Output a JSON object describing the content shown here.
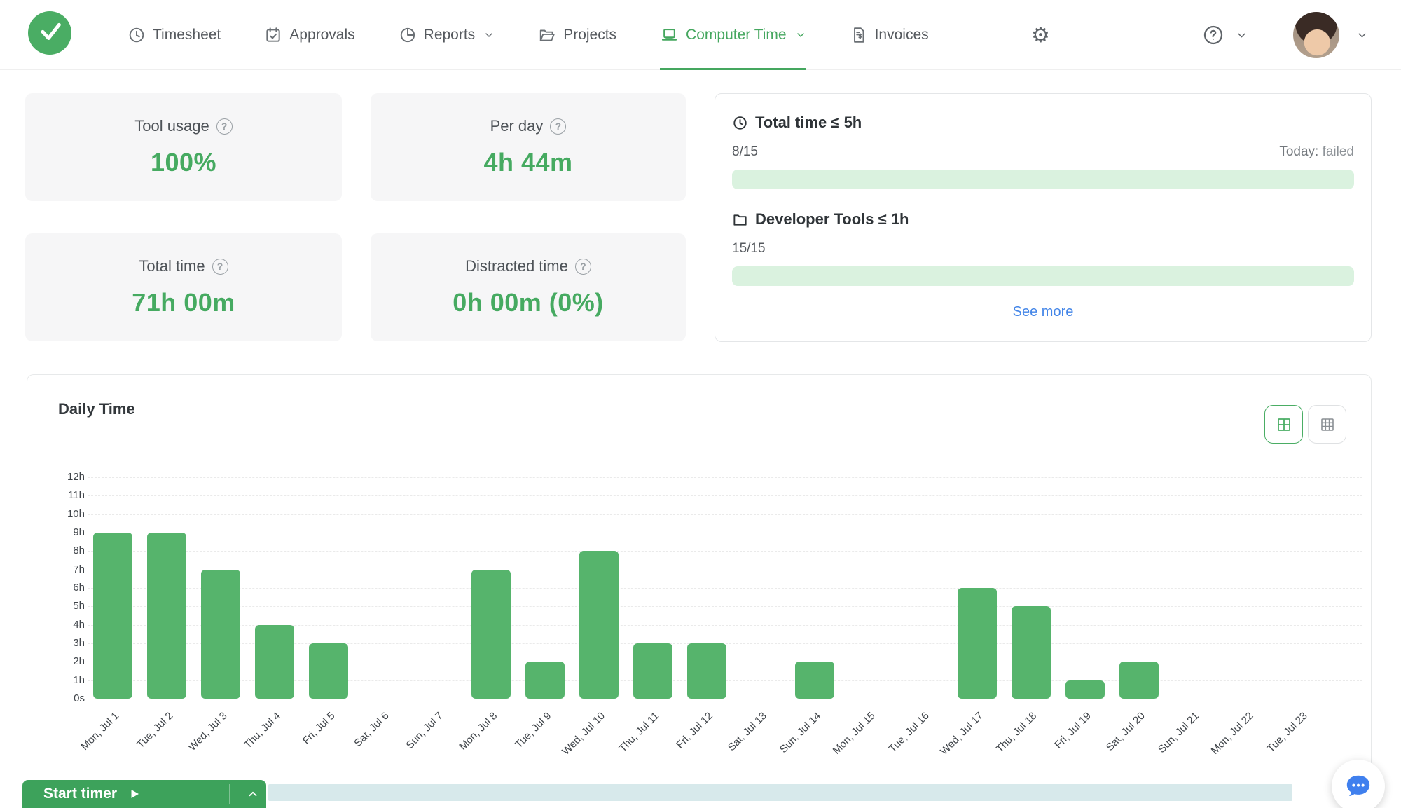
{
  "nav": {
    "items": [
      {
        "label": "Timesheet",
        "icon": "clock-icon",
        "active": false,
        "has_dropdown": false
      },
      {
        "label": "Approvals",
        "icon": "calendar-check-icon",
        "active": false,
        "has_dropdown": false
      },
      {
        "label": "Reports",
        "icon": "pie-chart-icon",
        "active": false,
        "has_dropdown": true
      },
      {
        "label": "Projects",
        "icon": "folder-icon",
        "active": false,
        "has_dropdown": false
      },
      {
        "label": "Computer Time",
        "icon": "laptop-icon",
        "active": true,
        "has_dropdown": true
      },
      {
        "label": "Invoices",
        "icon": "invoice-icon",
        "active": false,
        "has_dropdown": false
      }
    ],
    "right_icons": [
      "gear-icon",
      "help-icon",
      "avatar",
      "chevron-down-icon"
    ]
  },
  "summary_cards": [
    {
      "label": "Tool usage",
      "value": "100%"
    },
    {
      "label": "Per day",
      "value": "4h 44m"
    },
    {
      "label": "Total time",
      "value": "71h 00m"
    },
    {
      "label": "Distracted time",
      "value": "0h 00m (0%)"
    }
  ],
  "goals": {
    "items": [
      {
        "icon": "clock-icon",
        "title": "Total time ≤ 5h",
        "count": "8/15",
        "status_label": "Today:",
        "status_value": "failed",
        "progress_percent": 100
      },
      {
        "icon": "folder-icon",
        "title": "Developer Tools ≤ 1h",
        "count": "15/15",
        "status_label": "",
        "status_value": "",
        "progress_percent": 100
      }
    ],
    "see_more_label": "See more"
  },
  "daily_time": {
    "title": "Daily Time",
    "view_toggle": [
      "grid-2x2-icon",
      "grid-3x3-icon"
    ],
    "chart_data": {
      "type": "bar",
      "title": "Daily Time",
      "categories": [
        "Mon, Jul 1",
        "Tue, Jul 2",
        "Wed, Jul 3",
        "Thu, Jul 4",
        "Fri, Jul 5",
        "Sat, Jul 6",
        "Sun, Jul 7",
        "Mon, Jul 8",
        "Tue, Jul 9",
        "Wed, Jul 10",
        "Thu, Jul 11",
        "Fri, Jul 12",
        "Sat, Jul 13",
        "Sun, Jul 14",
        "Mon, Jul 15",
        "Tue, Jul 16",
        "Wed, Jul 17",
        "Thu, Jul 18",
        "Fri, Jul 19",
        "Sat, Jul 20",
        "Sun, Jul 21",
        "Mon, Jul 22",
        "Tue, Jul 23"
      ],
      "values_hours": [
        9,
        9,
        7,
        4,
        3,
        0,
        0,
        7,
        2,
        8,
        3,
        3,
        0,
        2,
        0,
        0,
        6,
        5,
        1,
        2,
        0,
        0,
        0
      ],
      "xlabel": "",
      "ylabel": "",
      "ytick_labels": [
        "0s",
        "1h",
        "2h",
        "3h",
        "4h",
        "5h",
        "6h",
        "7h",
        "8h",
        "9h",
        "10h",
        "11h",
        "12h"
      ],
      "ylim_hours": [
        0,
        12
      ],
      "grid": "dashed-horizontal",
      "legend": "none",
      "bar_color": "#56b46c"
    }
  },
  "timer": {
    "start_label": "Start timer"
  },
  "colors": {
    "accent_green": "#46aa61",
    "bar_green": "#56b46c",
    "button_green": "#3da25b",
    "progress_track_green": "#daf2df",
    "link_blue": "#4486e8",
    "chat_blue": "#4080ee",
    "range_bar": "#d7e9eb",
    "card_bg": "#f6f6f7"
  }
}
